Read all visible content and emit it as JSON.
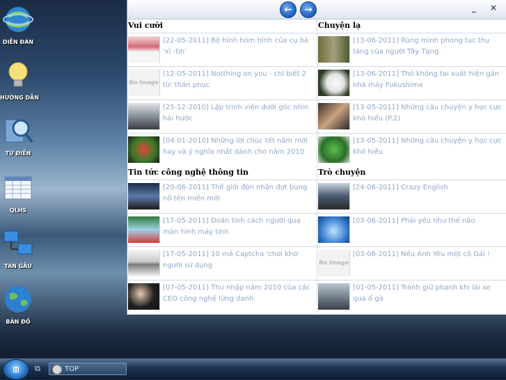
{
  "desktop": {
    "icons": [
      {
        "label": "DIỄN ĐÀN",
        "icon": "globe-icon"
      },
      {
        "label": "HƯỚNG DẪN",
        "icon": "lightbulb-icon"
      },
      {
        "label": "TỪ ĐIỂN",
        "icon": "magnifier-icon"
      },
      {
        "label": "QLHS",
        "icon": "spreadsheet-icon"
      },
      {
        "label": "TÁN GẪU",
        "icon": "network-icon"
      },
      {
        "label": "BẢN ĐỒ",
        "icon": "earth-icon"
      }
    ]
  },
  "window": {
    "back_label": "←",
    "forward_label": "→",
    "minimize_label": "_",
    "close_label": "×"
  },
  "sections": [
    {
      "title": "Vui cười",
      "items": [
        {
          "text": "[22-05-2011] Bộ hình hóm hỉnh của cụ bà 'xì -tin'",
          "thumb": "image"
        },
        {
          "text": "[12-05-2011] Notthing on you - chỉ biết 2 từ: thán phục",
          "thumb": "No Image"
        },
        {
          "text": "[25-12-2010] Lập trình viên dưới góc nhìn hài hước",
          "thumb": "image"
        },
        {
          "text": "[04-01-2010] Những lời chúc tết năm mới hay và ý nghĩa nhất dành cho năm 2010",
          "thumb": "image"
        }
      ]
    },
    {
      "title": "Chuyện lạ",
      "items": [
        {
          "text": "[13-06-2011] Rùng mình phong tục thụ táng của người Tây Tạng",
          "thumb": "image"
        },
        {
          "text": "[13-06-2011] Thỏ không tai xuất hiện gần nhà máy Fukushima",
          "thumb": "image"
        },
        {
          "text": "[13-05-2011] Những câu chuyện y học cực khó hiểu (P.2)",
          "thumb": "image"
        },
        {
          "text": "[13-05-2011] Những câu chuyện y học cực khó hiểu",
          "thumb": "image"
        }
      ]
    },
    {
      "title": "Tin tức công nghệ thông tin",
      "items": [
        {
          "text": "[20-06-2011] Thế giới đón nhận đợt bùng nổ tên miền mới",
          "thumb": "image"
        },
        {
          "text": "[17-05-2011] Đoán tính cách người qua màn hình máy tính",
          "thumb": "image"
        },
        {
          "text": "[17-05-2011] 10 mã Captcha 'chơi khó' người sử dụng",
          "thumb": "image"
        },
        {
          "text": "[07-05-2011] Thu nhập năm 2010 của các CEO công nghệ lừng danh",
          "thumb": "image"
        }
      ]
    },
    {
      "title": "Trò chuyện",
      "items": [
        {
          "text": "[24-06-2011] Crazy English",
          "thumb": "image"
        },
        {
          "text": "[03-06-2011] Phải yêu như thế nào",
          "thumb": "image"
        },
        {
          "text": "[03-06-2011] Nếu Anh Yêu một cô Gái !",
          "thumb": "No Image"
        },
        {
          "text": "[01-05-2011] Tránh giữ phanh khi lái xe qua ổ gà",
          "thumb": "image"
        }
      ]
    }
  ],
  "taskbar": {
    "start_label": "⊞",
    "top_button_label": "TOP"
  },
  "colors": {
    "link": "#8fa6c8",
    "accent": "#1f5fc0"
  }
}
